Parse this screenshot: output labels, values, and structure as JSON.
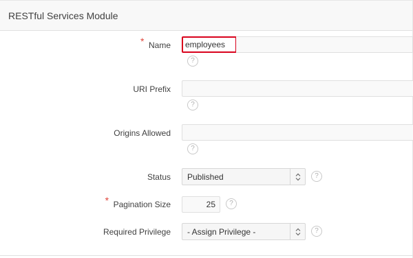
{
  "region": {
    "title": "RESTful Services Module"
  },
  "form": {
    "name": {
      "label": "Name",
      "required_mark": "*",
      "value": "employees"
    },
    "uri_prefix": {
      "label": "URI Prefix",
      "value": ""
    },
    "origins_allowed": {
      "label": "Origins Allowed",
      "value": ""
    },
    "status": {
      "label": "Status",
      "selected": "Published"
    },
    "pagination_size": {
      "label": "Pagination Size",
      "required_mark": "*",
      "value": "25"
    },
    "required_privilege": {
      "label": "Required Privilege",
      "selected": "- Assign Privilege -"
    }
  },
  "help_icon_glyph": "?",
  "icons": {
    "help": "question-circle-icon",
    "select_arrows": "chevron-up-down-icon"
  },
  "colors": {
    "required": "#e0463b",
    "highlight_border": "#d9001b"
  }
}
